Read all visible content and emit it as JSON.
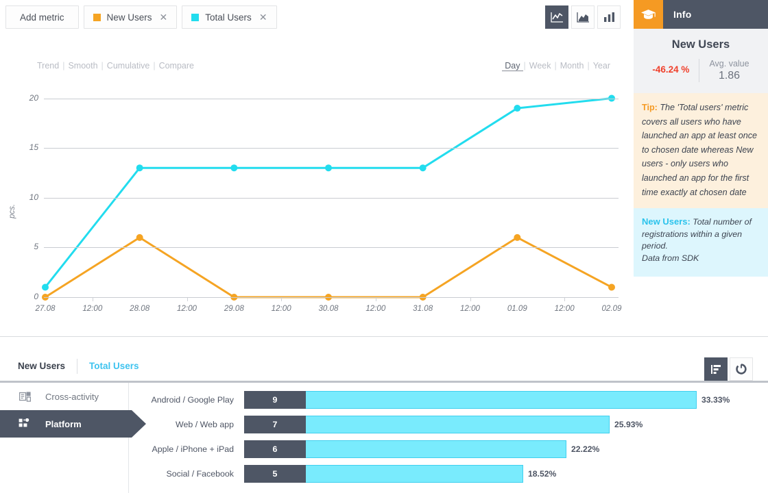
{
  "toolbar": {
    "add_metric_label": "Add metric",
    "metrics": [
      {
        "label": "New Users",
        "color": "#f5a423",
        "close_icon": "close-icon"
      },
      {
        "label": "Total Users",
        "color": "#22dcee",
        "close_icon": "close-icon"
      }
    ],
    "chart_types": [
      {
        "name": "line-chart-icon",
        "selected": true
      },
      {
        "name": "area-chart-icon",
        "selected": false
      },
      {
        "name": "bar-chart-icon",
        "selected": false
      }
    ]
  },
  "info_panel": {
    "cap_icon": "graduation-cap-icon",
    "title": "Info",
    "stat": {
      "metric_name": "New Users",
      "delta": "-46.24 %",
      "delta_color": "#f0402b",
      "avg_label": "Avg. value",
      "avg_value": "1.86"
    },
    "tip": {
      "label": "Tip:",
      "text": "The 'Total users' metric covers all users who have launched an app at least once to chosen date whereas New users - only users who launched an app for the first time exactly at chosen date"
    },
    "definition": {
      "label": "New Users:",
      "text": "Total number of registrations within a given period.",
      "source": "Data from SDK"
    }
  },
  "chart_controls": {
    "modes": [
      "Trend",
      "Smooth",
      "Cumulative",
      "Compare"
    ],
    "periods": [
      "Day",
      "Week",
      "Month",
      "Year"
    ],
    "active_period": "Day"
  },
  "chart_data": {
    "type": "line",
    "title": "",
    "xlabel": "",
    "ylabel": "pcs.",
    "ylim": [
      0,
      21
    ],
    "yticks": [
      0,
      5,
      10,
      15,
      20
    ],
    "grid": true,
    "legend": "top",
    "categories": [
      "27.08",
      "28.08",
      "29.08",
      "30.08",
      "31.08",
      "01.09",
      "02.09"
    ],
    "xtick_labels": [
      "27.08",
      "12:00",
      "28.08",
      "12:00",
      "29.08",
      "12:00",
      "30.08",
      "12:00",
      "31.08",
      "12:00",
      "01.09",
      "12:00",
      "02.09"
    ],
    "series": [
      {
        "name": "Total Users",
        "color": "#22dcee",
        "values": [
          1,
          13,
          13,
          13,
          13,
          19,
          20
        ]
      },
      {
        "name": "New Users",
        "color": "#f5a423",
        "values": [
          0,
          6,
          0,
          0,
          0,
          6,
          1
        ]
      }
    ]
  },
  "bottom": {
    "tabs": [
      {
        "label": "New Users",
        "active": true
      },
      {
        "label": "Total Users",
        "active": false
      }
    ],
    "view_icons": [
      {
        "name": "bar-list-icon",
        "selected": true
      },
      {
        "name": "donut-chart-icon",
        "selected": false
      }
    ],
    "side_nav": [
      {
        "label": "Cross-activity",
        "icon": "cross-activity-icon",
        "selected": false
      },
      {
        "label": "Platform",
        "icon": "platform-icon",
        "selected": true
      }
    ]
  },
  "breakdown": {
    "type": "bar",
    "max_value": 9,
    "rows": [
      {
        "label": "Android / Google Play",
        "count": "9",
        "percent": "33.33%",
        "pct_num": 33.33
      },
      {
        "label": "Web / Web app",
        "count": "7",
        "percent": "25.93%",
        "pct_num": 25.93
      },
      {
        "label": "Apple / iPhone + iPad",
        "count": "6",
        "percent": "22.22%",
        "pct_num": 22.22
      },
      {
        "label": "Social / Facebook",
        "count": "5",
        "percent": "18.52%",
        "pct_num": 18.52
      }
    ]
  }
}
